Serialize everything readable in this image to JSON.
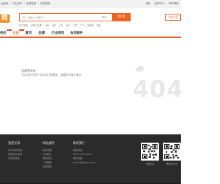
{
  "topbar": {
    "left": [
      "企业版",
      "行业资讯",
      "免费注册",
      "在线咨询"
    ],
    "right": [
      "首页",
      "会员中心",
      "网站导航"
    ]
  },
  "logo": {
    "text": "网"
  },
  "search": {
    "placeholder": "请输入关键词",
    "type": "供应",
    "button": "搜 索"
  },
  "publish": {
    "label": "+发产品"
  },
  "hotwords": [
    "热门搜索",
    "深圳产品展",
    "上海",
    "北京",
    "山东",
    "浙江",
    "江苏",
    "广州",
    "福建省",
    "湖北"
  ],
  "nav": {
    "items": [
      "供应",
      "企业",
      "黄页",
      "品牌",
      "行业资讯",
      "会员服务"
    ],
    "hot_badge": "HOT"
  },
  "notfound": {
    "title": "页面不存在",
    "desc": "您访问的页面不存在或已被删除，请重新检查后重试",
    "code": "404"
  },
  "footer": {
    "cols": [
      {
        "title": "我是买家",
        "links": [
          "发布求购信息",
          "搜索供应信息",
          "采购商服务"
        ]
      },
      {
        "title": "网站服务",
        "links": [
          "网站地图",
          "VIP服务",
          "联系我们",
          "广告服务",
          "网站帮助"
        ]
      },
      {
        "title": "联系我们",
        "links": [
          "客服电话",
          "0512-12345678",
          "联系邮箱",
          "admin@qiyeyi.com"
        ]
      }
    ],
    "qr": [
      "扫码关注",
      "微信公众号"
    ]
  }
}
